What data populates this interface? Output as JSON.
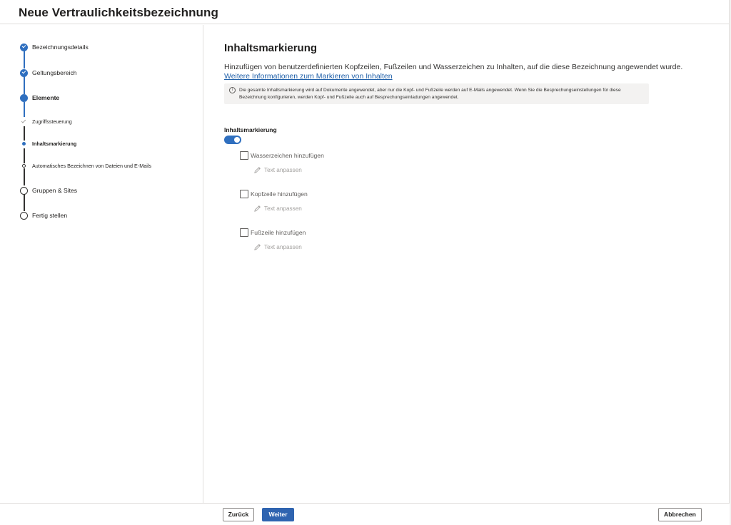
{
  "window": {
    "title": "Neue Vertraulichkeitsbezeichnung"
  },
  "steps": [
    {
      "label": "Bezeichnungsdetails",
      "state": "done"
    },
    {
      "label": "Geltungsbereich",
      "state": "done"
    },
    {
      "label": "Elemente",
      "state": "current"
    },
    {
      "label": "Zugriffssteuerung",
      "state": "sub-done"
    },
    {
      "label": "Inhaltsmarkierung",
      "state": "sub-current"
    },
    {
      "label": "Automatisches Bezeichnen von Dateien und E-Mails",
      "state": "sub-pending"
    },
    {
      "label": "Gruppen & Sites",
      "state": "pending"
    },
    {
      "label": "Fertig stellen",
      "state": "pending"
    }
  ],
  "main": {
    "title": "Inhaltsmarkierung",
    "description": "Hinzufügen von benutzerdefinierten Kopfzeilen, Fußzeilen und Wasserzeichen zu Inhalten, auf die diese Bezeichnung angewendet wurde.",
    "link": "Weitere Informationen zum Markieren von Inhalten",
    "info": "Die gesamte Inhaltsmarkierung wird auf Dokumente angewendet, aber nur die Kopf- und Fußzeile werden auf E-Mails angewendet. Wenn Sie die Besprechungseinstellungen für diese Bezeichnung konfigurieren, werden Kopf- und Fußzeile auch auf Besprechungseinladungen angewendet.",
    "toggle_label": "Inhaltsmarkierung",
    "toggle_on": true,
    "options": [
      {
        "label": "Wasserzeichen hinzufügen",
        "edit": "Text anpassen",
        "checked": false
      },
      {
        "label": "Kopfzeile hinzufügen",
        "edit": "Text anpassen",
        "checked": false
      },
      {
        "label": "Fußzeile hinzufügen",
        "edit": "Text anpassen",
        "checked": false
      }
    ]
  },
  "footer": {
    "back": "Zurück",
    "next": "Weiter",
    "cancel": "Abbrechen"
  },
  "colors": {
    "accent": "#2f6fbf",
    "link": "#1f5fa8"
  }
}
